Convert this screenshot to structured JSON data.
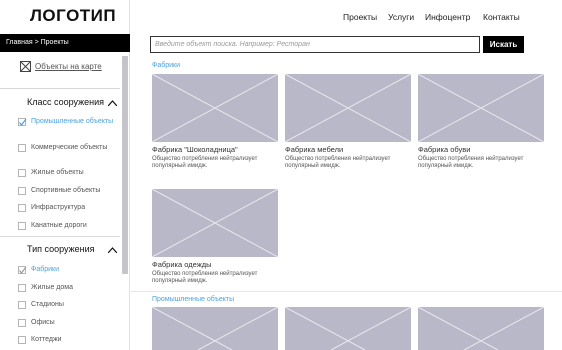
{
  "header": {
    "logo": "ЛОГОТИП",
    "nav": [
      "Проекты",
      "Услуги",
      "Инфоцентр",
      "Контакты"
    ]
  },
  "breadcrumb": "Главная > Проекты",
  "map_link": "Объекты на карте",
  "filters": {
    "class_title": "Класс сооружения",
    "class_items": [
      {
        "label": "Промышленные объекты",
        "checked": true
      },
      {
        "label": "Коммерческие объекты",
        "checked": false
      },
      {
        "label": "Жилые объекты",
        "checked": false
      },
      {
        "label": "Спортивные объекты",
        "checked": false
      },
      {
        "label": "Инфраструктура",
        "checked": false
      },
      {
        "label": "Канатные дороги",
        "checked": false
      }
    ],
    "type_title": "Тип сооружения",
    "type_items": [
      {
        "label": "Фабрики",
        "checked": true
      },
      {
        "label": "Жилые дома",
        "checked": false
      },
      {
        "label": "Стадионы",
        "checked": false
      },
      {
        "label": "Офисы",
        "checked": false
      },
      {
        "label": "Коттеджи",
        "checked": false
      }
    ]
  },
  "search": {
    "placeholder": "Введите объект поиска. Например: Ресторан",
    "button": "Искать"
  },
  "sections": [
    {
      "label": "Фабрики",
      "tiles": [
        {
          "title": "Фабрика \"Шоколадница\"",
          "desc": "Общество потребления нейтрализует популярный имидж."
        },
        {
          "title": "Фабрика мебели",
          "desc": "Общество потребления нейтрализует популярный имидж."
        },
        {
          "title": "Фабрика обуви",
          "desc": "Общество потребления нейтрализует популярный имидж."
        },
        {
          "title": "Фабрика одежды",
          "desc": "Общество потребления нейтрализует популярный имидж."
        }
      ]
    },
    {
      "label": "Промышленные объекты",
      "tiles": []
    }
  ],
  "colors": {
    "accent": "#4aa3df",
    "placeholder_image": "#b9b8c8"
  }
}
